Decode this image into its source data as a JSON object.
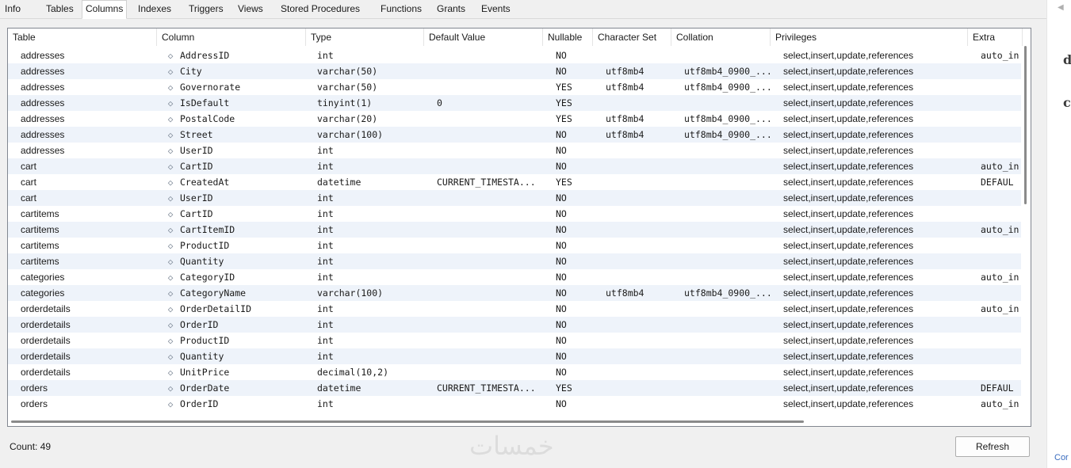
{
  "tabs": [
    {
      "label": "Info",
      "active": false
    },
    {
      "label": "Tables",
      "active": false
    },
    {
      "label": "Columns",
      "active": true
    },
    {
      "label": "Indexes",
      "active": false
    },
    {
      "label": "Triggers",
      "active": false
    },
    {
      "label": "Views",
      "active": false
    },
    {
      "label": "Stored Procedures",
      "active": false
    },
    {
      "label": "Functions",
      "active": false
    },
    {
      "label": "Grants",
      "active": false
    },
    {
      "label": "Events",
      "active": false
    }
  ],
  "grid": {
    "columns": [
      "Table",
      "Column",
      "Type",
      "Default Value",
      "Nullable",
      "Character Set",
      "Collation",
      "Privileges",
      "Extra"
    ],
    "column_icon": "column-diamond-icon",
    "rows": [
      [
        "addresses",
        "AddressID",
        "int",
        "",
        "NO",
        "",
        "",
        "select,insert,update,references",
        "auto_in"
      ],
      [
        "addresses",
        "City",
        "varchar(50)",
        "",
        "NO",
        "utf8mb4",
        "utf8mb4_0900_...",
        "select,insert,update,references",
        ""
      ],
      [
        "addresses",
        "Governorate",
        "varchar(50)",
        "",
        "YES",
        "utf8mb4",
        "utf8mb4_0900_...",
        "select,insert,update,references",
        ""
      ],
      [
        "addresses",
        "IsDefault",
        "tinyint(1)",
        "0",
        "YES",
        "",
        "",
        "select,insert,update,references",
        ""
      ],
      [
        "addresses",
        "PostalCode",
        "varchar(20)",
        "",
        "YES",
        "utf8mb4",
        "utf8mb4_0900_...",
        "select,insert,update,references",
        ""
      ],
      [
        "addresses",
        "Street",
        "varchar(100)",
        "",
        "NO",
        "utf8mb4",
        "utf8mb4_0900_...",
        "select,insert,update,references",
        ""
      ],
      [
        "addresses",
        "UserID",
        "int",
        "",
        "NO",
        "",
        "",
        "select,insert,update,references",
        ""
      ],
      [
        "cart",
        "CartID",
        "int",
        "",
        "NO",
        "",
        "",
        "select,insert,update,references",
        "auto_in"
      ],
      [
        "cart",
        "CreatedAt",
        "datetime",
        "CURRENT_TIMESTA...",
        "YES",
        "",
        "",
        "select,insert,update,references",
        "DEFAUL"
      ],
      [
        "cart",
        "UserID",
        "int",
        "",
        "NO",
        "",
        "",
        "select,insert,update,references",
        ""
      ],
      [
        "cartitems",
        "CartID",
        "int",
        "",
        "NO",
        "",
        "",
        "select,insert,update,references",
        ""
      ],
      [
        "cartitems",
        "CartItemID",
        "int",
        "",
        "NO",
        "",
        "",
        "select,insert,update,references",
        "auto_in"
      ],
      [
        "cartitems",
        "ProductID",
        "int",
        "",
        "NO",
        "",
        "",
        "select,insert,update,references",
        ""
      ],
      [
        "cartitems",
        "Quantity",
        "int",
        "",
        "NO",
        "",
        "",
        "select,insert,update,references",
        ""
      ],
      [
        "categories",
        "CategoryID",
        "int",
        "",
        "NO",
        "",
        "",
        "select,insert,update,references",
        "auto_in"
      ],
      [
        "categories",
        "CategoryName",
        "varchar(100)",
        "",
        "NO",
        "utf8mb4",
        "utf8mb4_0900_...",
        "select,insert,update,references",
        ""
      ],
      [
        "orderdetails",
        "OrderDetailID",
        "int",
        "",
        "NO",
        "",
        "",
        "select,insert,update,references",
        "auto_in"
      ],
      [
        "orderdetails",
        "OrderID",
        "int",
        "",
        "NO",
        "",
        "",
        "select,insert,update,references",
        ""
      ],
      [
        "orderdetails",
        "ProductID",
        "int",
        "",
        "NO",
        "",
        "",
        "select,insert,update,references",
        ""
      ],
      [
        "orderdetails",
        "Quantity",
        "int",
        "",
        "NO",
        "",
        "",
        "select,insert,update,references",
        ""
      ],
      [
        "orderdetails",
        "UnitPrice",
        "decimal(10,2)",
        "",
        "NO",
        "",
        "",
        "select,insert,update,references",
        ""
      ],
      [
        "orders",
        "OrderDate",
        "datetime",
        "CURRENT_TIMESTA...",
        "YES",
        "",
        "",
        "select,insert,update,references",
        "DEFAUL"
      ],
      [
        "orders",
        "OrderID",
        "int",
        "",
        "NO",
        "",
        "",
        "select,insert,update,references",
        "auto_in"
      ]
    ]
  },
  "footer": {
    "count_label": "Count: 49",
    "watermark": "خمسات",
    "refresh_label": "Refresh"
  },
  "right_strip": {
    "collapse_icon": "collapse-left-icon",
    "letters": [
      "d",
      "c"
    ],
    "link_text": "Cor"
  }
}
